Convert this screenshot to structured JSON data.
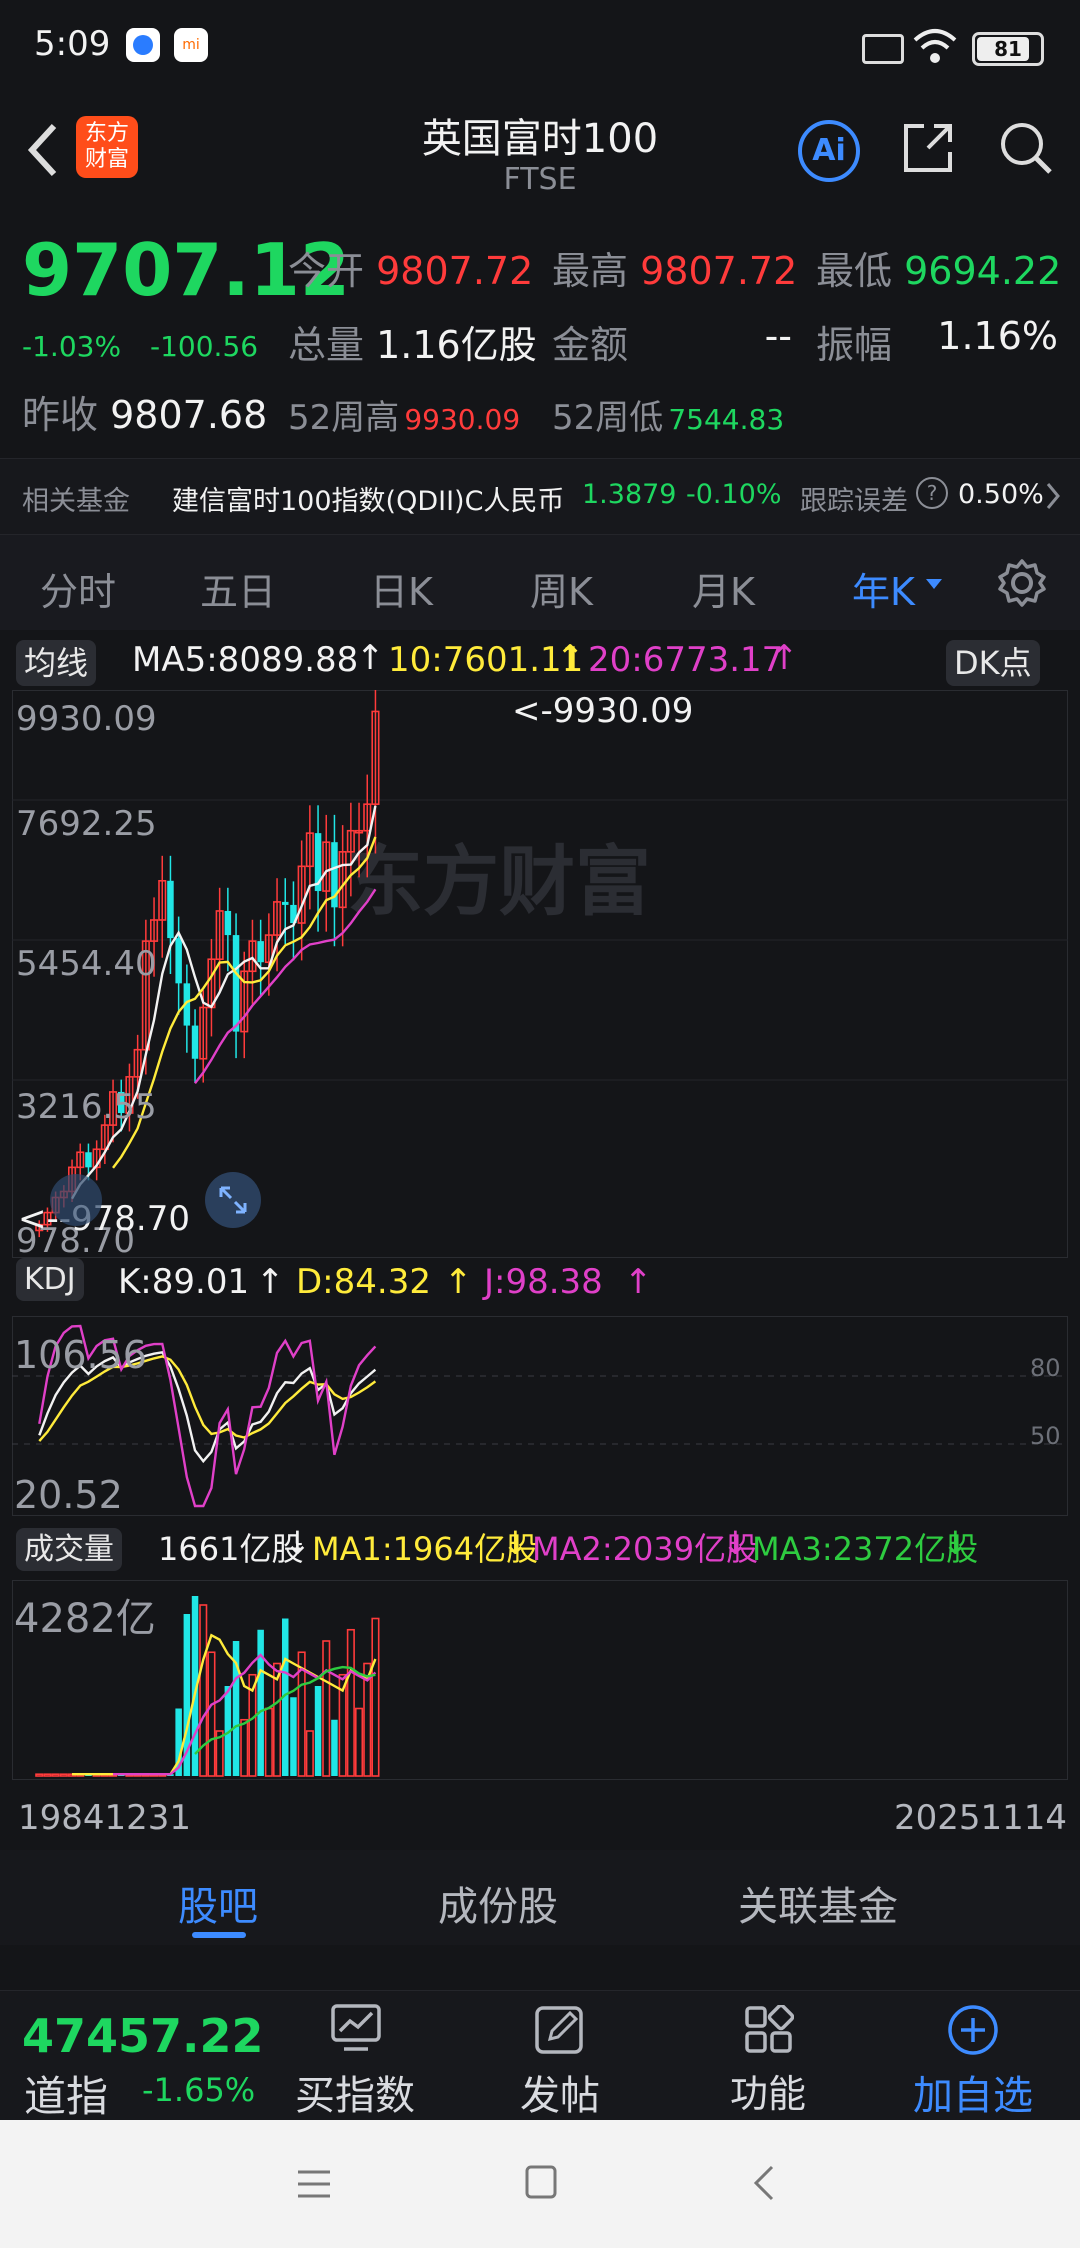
{
  "status": {
    "time": "5:09",
    "battery": "81"
  },
  "header": {
    "title": "英国富时100",
    "subtitle": "FTSE",
    "logo_text_line1": "东方",
    "logo_text_line2": "财富",
    "ai_label": "Ai"
  },
  "quote": {
    "price": "9707.12",
    "change_pct": "-1.03%",
    "change": "-100.56",
    "prev_close_label": "昨收",
    "prev_close": "9807.68",
    "open_label": "今开",
    "open": "9807.72",
    "high_label": "最高",
    "high": "9807.72",
    "low_label": "最低",
    "low": "9694.22",
    "volume_label": "总量",
    "volume": "1.16亿股",
    "amount_label": "金额",
    "amount": "--",
    "amplitude_label": "振幅",
    "amplitude": "1.16%",
    "wk52_high_label": "52周高",
    "wk52_high": "9930.09",
    "wk52_low_label": "52周低",
    "wk52_low": "7544.83"
  },
  "fund": {
    "label": "相关基金",
    "name": "建信富时100指数(QDII)C人民币",
    "nav": "1.3879",
    "change": "-0.10%",
    "tracking_label": "跟踪误差",
    "tracking_value": "0.50%"
  },
  "tabs": {
    "items": [
      "分时",
      "五日",
      "日K",
      "周K",
      "月K",
      "年K"
    ],
    "active": "年K"
  },
  "ma": {
    "selector": "均线",
    "ma5": "MA5:8089.88",
    "ma10": "10:7601.11",
    "ma20": "20:6773.17",
    "dk_button": "DK点"
  },
  "kline_axis": {
    "y_labels": [
      "9930.09",
      "7692.25",
      "5454.40",
      "3216.55",
      "978.70"
    ],
    "max_marker": "<-9930.09",
    "min_marker": "<--978.70",
    "watermark": "东方财富"
  },
  "kdj": {
    "selector": "KDJ",
    "k": "K:89.01",
    "d": "D:84.32",
    "j": "J:98.38",
    "y_top": "106.56",
    "y_bottom": "20.52",
    "ref80": "80",
    "ref50": "50"
  },
  "vol": {
    "selector": "成交量",
    "current": "1661亿股",
    "ma1": "MA1:1964亿股",
    "ma2": "MA2:2039亿股",
    "ma3": "MA3:2372亿股",
    "y_top": "4282亿"
  },
  "date_axis": {
    "start": "19841231",
    "end": "20251114"
  },
  "bottom_tabs": {
    "items": [
      "股吧",
      "成份股",
      "关联基金"
    ],
    "active": "股吧"
  },
  "toolbar": {
    "index_value": "47457.22",
    "index_name": "道指",
    "index_change": "-1.65%",
    "buy": "买指数",
    "post": "发帖",
    "func": "功能",
    "add": "加自选"
  },
  "colors": {
    "up": "#ff3b3b",
    "down": "#1ed760",
    "accent": "#3d8bff",
    "cyan": "#21e6e6"
  },
  "chart_data": {
    "type": "candlestick",
    "period": "yearly",
    "price_ylim": [
      978.7,
      9930.09
    ],
    "closes_approx": [
      1200,
      1400,
      1650,
      1750,
      2150,
      2400,
      2150,
      2450,
      2850,
      3400,
      3050,
      3650,
      4100,
      5900,
      6250,
      6900,
      5950,
      5200,
      4500,
      3950,
      4800,
      5600,
      6400,
      6000,
      4400,
      5400,
      5900,
      5550,
      6000,
      6550,
      6500,
      6200,
      7140,
      7690,
      6730,
      7540,
      6460,
      7380,
      7730,
      7730,
      8170,
      9707.12
    ],
    "volume_max_label": "4282亿"
  }
}
